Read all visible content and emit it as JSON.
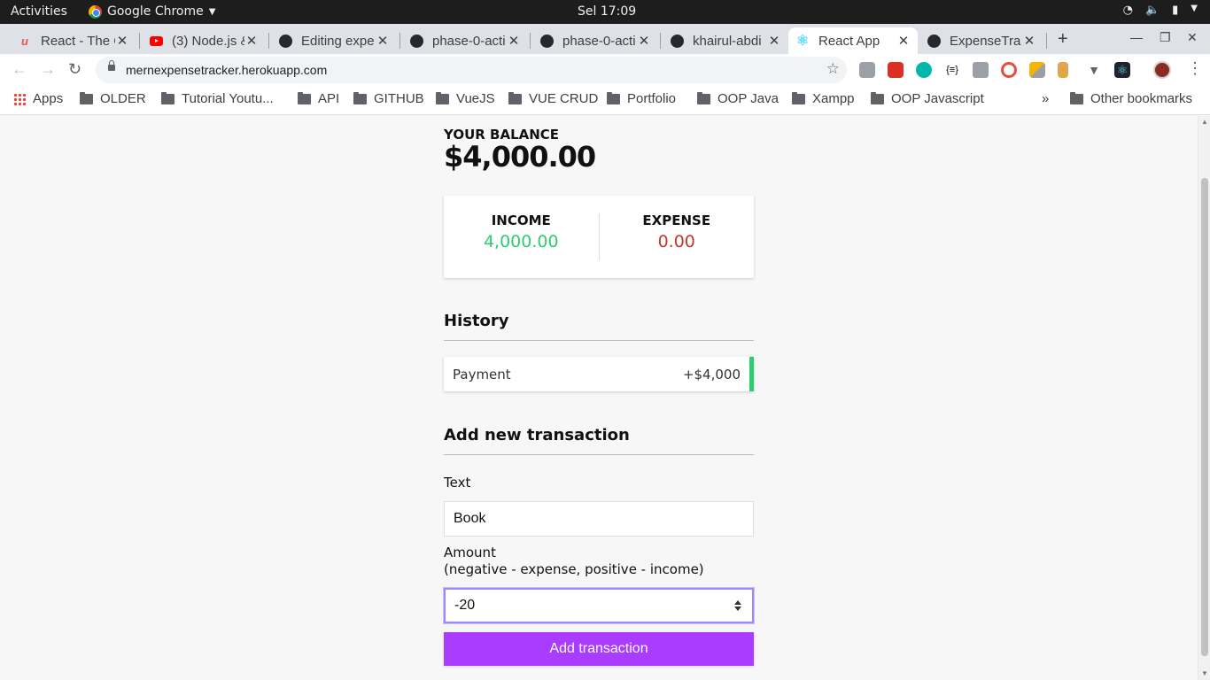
{
  "os_bar": {
    "activities": "Activities",
    "app_name": "Google Chrome",
    "clock": "Sel 17:09"
  },
  "tabs": [
    {
      "title": "React - The C",
      "icon": "udemy-icon"
    },
    {
      "title": "(3) Node.js &",
      "icon": "youtube-icon"
    },
    {
      "title": "Editing expe",
      "icon": "github-icon"
    },
    {
      "title": "phase-0-acti",
      "icon": "github-icon"
    },
    {
      "title": "phase-0-acti",
      "icon": "github-icon"
    },
    {
      "title": "khairul-abdi",
      "icon": "github-icon"
    },
    {
      "title": "React App",
      "icon": "react-icon",
      "active": true
    },
    {
      "title": "ExpenseTra",
      "icon": "github-icon"
    }
  ],
  "address_bar": {
    "url": "mernexpensetracker.herokuapp.com"
  },
  "bookmarks": {
    "apps": "Apps",
    "items": [
      "OLDER",
      "Tutorial Youtu...",
      "API",
      "GITHUB",
      "VueJS",
      "VUE CRUD",
      "Portfolio",
      "OOP Java",
      "Xampp",
      "OOP Javascript"
    ],
    "overflow": "»",
    "other": "Other bookmarks"
  },
  "app": {
    "balance_label": "YOUR BALANCE",
    "balance_value": "$4,000.00",
    "income_label": "INCOME",
    "income_value": "4,000.00",
    "expense_label": "EXPENSE",
    "expense_value": "0.00",
    "history_title": "History",
    "history": [
      {
        "text": "Payment",
        "amount": "+$4,000"
      }
    ],
    "add_title": "Add new transaction",
    "text_label": "Text",
    "text_value": "Book",
    "amount_label": "Amount",
    "amount_hint": "(negative - expense, positive - income)",
    "amount_value": "-20",
    "submit_label": "Add transaction"
  },
  "colors": {
    "income": "#2ecc71",
    "expense": "#c0392b",
    "button": "#a93cff",
    "focus": "#9c88ff"
  }
}
